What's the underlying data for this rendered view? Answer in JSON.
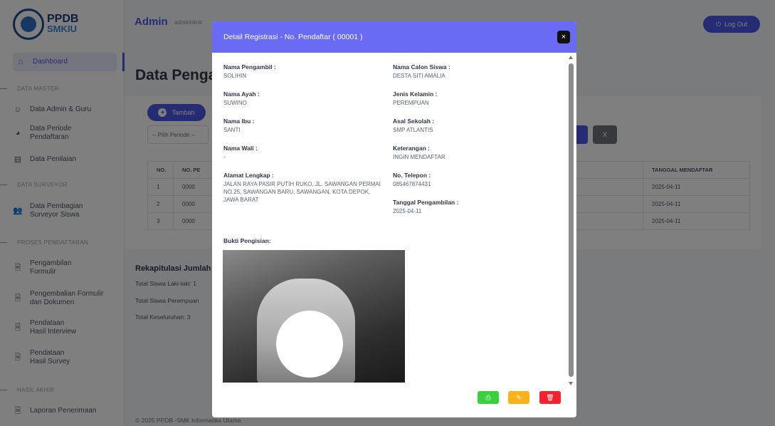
{
  "sidebar": {
    "logo_title": "PPDB",
    "logo_sub": "SMKIU",
    "items": [
      {
        "label": "Dashboard",
        "icon": "home-icon"
      },
      {
        "label": "Data Admin & Guru",
        "icon": "user-circle-icon"
      },
      {
        "label": "Data Periode Pendaftaran",
        "icon": "pie-chart-icon"
      },
      {
        "label": "Data Penilaian",
        "icon": "document-icon"
      },
      {
        "label": "Data Pembagian Surveyor Siswa",
        "icon": "users-icon"
      },
      {
        "label": "Pengambilan Formulir",
        "icon": "file-icon"
      },
      {
        "label": "Pengembalian Formulir dan Dokumen",
        "icon": "file-icon"
      },
      {
        "label": "Pendataan Hasil Interview",
        "icon": "file-icon"
      },
      {
        "label": "Pendataan Hasil Survey",
        "icon": "file-icon"
      },
      {
        "label": "Laporan Penerimaan",
        "icon": "file-icon"
      }
    ],
    "sections": [
      "DATA MASTER",
      "DATA SURVEYOR",
      "PROSES PENDAFTARAN",
      "HASIL AKHIR"
    ]
  },
  "topbar": {
    "admin_name": "Admin",
    "admin_role": "administrat",
    "logout_label": "Log Out"
  },
  "main": {
    "page_title": "Data Penga",
    "tambah_label": "Tambah",
    "periode_placeholder": "-- Pilih Periode --",
    "clear_label": "X",
    "table": {
      "headers": [
        "NO.",
        "NO. PE",
        "TANGGAL MENDAFTAR"
      ],
      "rows": [
        [
          "1",
          "0000",
          "2025-04-11"
        ],
        [
          "2",
          "0000",
          "2025-04-11"
        ],
        [
          "3",
          "0000",
          "2025-04-11"
        ]
      ]
    },
    "rekap_title": "Rekapitulasi Jumlah",
    "rekap_laki": "Total Siswa Laki-laki: 1",
    "rekap_perempuan": "Total Siswa Perempuan",
    "rekap_total": "Total Keseluruhan: 3",
    "footer": "© 2025 PPDB -SMK Informatika Utama"
  },
  "modal": {
    "title": "Detail Registrasi - No. Pendaftar ( 00001 )",
    "close_label": "×",
    "fields_left": [
      {
        "label": "Nama Pengambil :",
        "value": "SOLIHIN"
      },
      {
        "label": "Nama Ayah :",
        "value": "SUWINO"
      },
      {
        "label": "Nama Ibu :",
        "value": "SANTI"
      },
      {
        "label": "Nama Wali :",
        "value": "-"
      },
      {
        "label": "Alamat Lengkap :",
        "value": "JALAN RAYA PASIR PUTIH RUKO, JL. SAWANGAN PERMAI NO.25, SAWANGAN BARU, SAWANGAN, KOTA DEPOK, JAWA BARAT"
      }
    ],
    "fields_right": [
      {
        "label": "Nama Calon Siswa :",
        "value": "DESTA SITI AMALIA"
      },
      {
        "label": "Jenis Kelamin :",
        "value": "PEREMPUAN"
      },
      {
        "label": "Asal Sekolah :",
        "value": "SMP ATLANTIS"
      },
      {
        "label": "Keterangan :",
        "value": "INGIN MENDAFTAR"
      },
      {
        "label": "No. Telepon :",
        "value": "085467874431"
      },
      {
        "label": "Tanggal Pengambilan :",
        "value": "2025-04-11"
      }
    ],
    "bukti_label": "Bukti Pengisian:",
    "action_icons": [
      "print-icon",
      "edit-icon",
      "trash-icon"
    ],
    "colors": {
      "header": "#6a6bf5",
      "print": "#36d13d",
      "edit": "#ffb11a",
      "delete": "#f5222d"
    }
  }
}
